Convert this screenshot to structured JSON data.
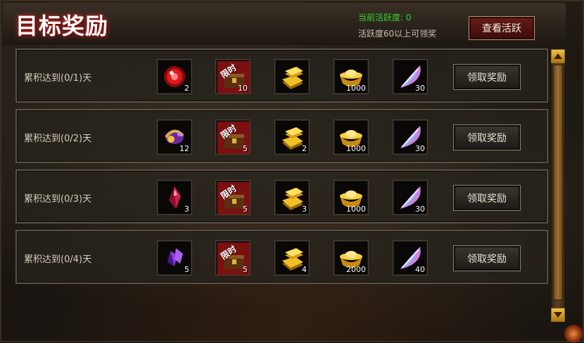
{
  "panel": {
    "title": "目标奖励",
    "activity_label": "当前活跃度: 0",
    "activity_hint": "活跃度60以上可领奖",
    "view_button": "查看活跃"
  },
  "rows": [
    {
      "label": "累积达到(0/1)天",
      "claim": "领取奖励",
      "items": [
        {
          "icon": "red-orb-icon",
          "qty": "2"
        },
        {
          "icon": "limited-chest-icon",
          "qty": "10"
        },
        {
          "icon": "gold-bars-icon",
          "qty": ""
        },
        {
          "icon": "gold-ingot-icon",
          "qty": "1000"
        },
        {
          "icon": "pink-feather-icon",
          "qty": "30"
        }
      ]
    },
    {
      "label": "累积达到(0/2)天",
      "claim": "领取奖励",
      "items": [
        {
          "icon": "purple-swirl-icon",
          "qty": "12"
        },
        {
          "icon": "limited-chest-icon",
          "qty": "5"
        },
        {
          "icon": "gold-bars-icon",
          "qty": "2"
        },
        {
          "icon": "gold-ingot-icon",
          "qty": "1000"
        },
        {
          "icon": "pink-feather-icon",
          "qty": "30"
        }
      ]
    },
    {
      "label": "累积达到(0/3)天",
      "claim": "领取奖励",
      "items": [
        {
          "icon": "red-crystal-icon",
          "qty": "3"
        },
        {
          "icon": "limited-chest-icon",
          "qty": "5"
        },
        {
          "icon": "gold-bars-icon",
          "qty": "3"
        },
        {
          "icon": "gold-ingot-icon",
          "qty": "1000"
        },
        {
          "icon": "pink-feather-icon",
          "qty": "30"
        }
      ]
    },
    {
      "label": "累积达到(0/4)天",
      "claim": "领取奖励",
      "items": [
        {
          "icon": "purple-crystal-icon",
          "qty": "5"
        },
        {
          "icon": "limited-chest-icon",
          "qty": "5"
        },
        {
          "icon": "gold-bars-icon",
          "qty": "4"
        },
        {
          "icon": "gold-ingot-icon",
          "qty": "2000"
        },
        {
          "icon": "pink-feather-icon",
          "qty": "40"
        }
      ]
    }
  ],
  "limited_tag": "限时",
  "colors": {
    "activity_green": "#31d431",
    "title_red_glow": "#d03030",
    "gold": "#e0a820",
    "panel_bg": "#15120e"
  }
}
